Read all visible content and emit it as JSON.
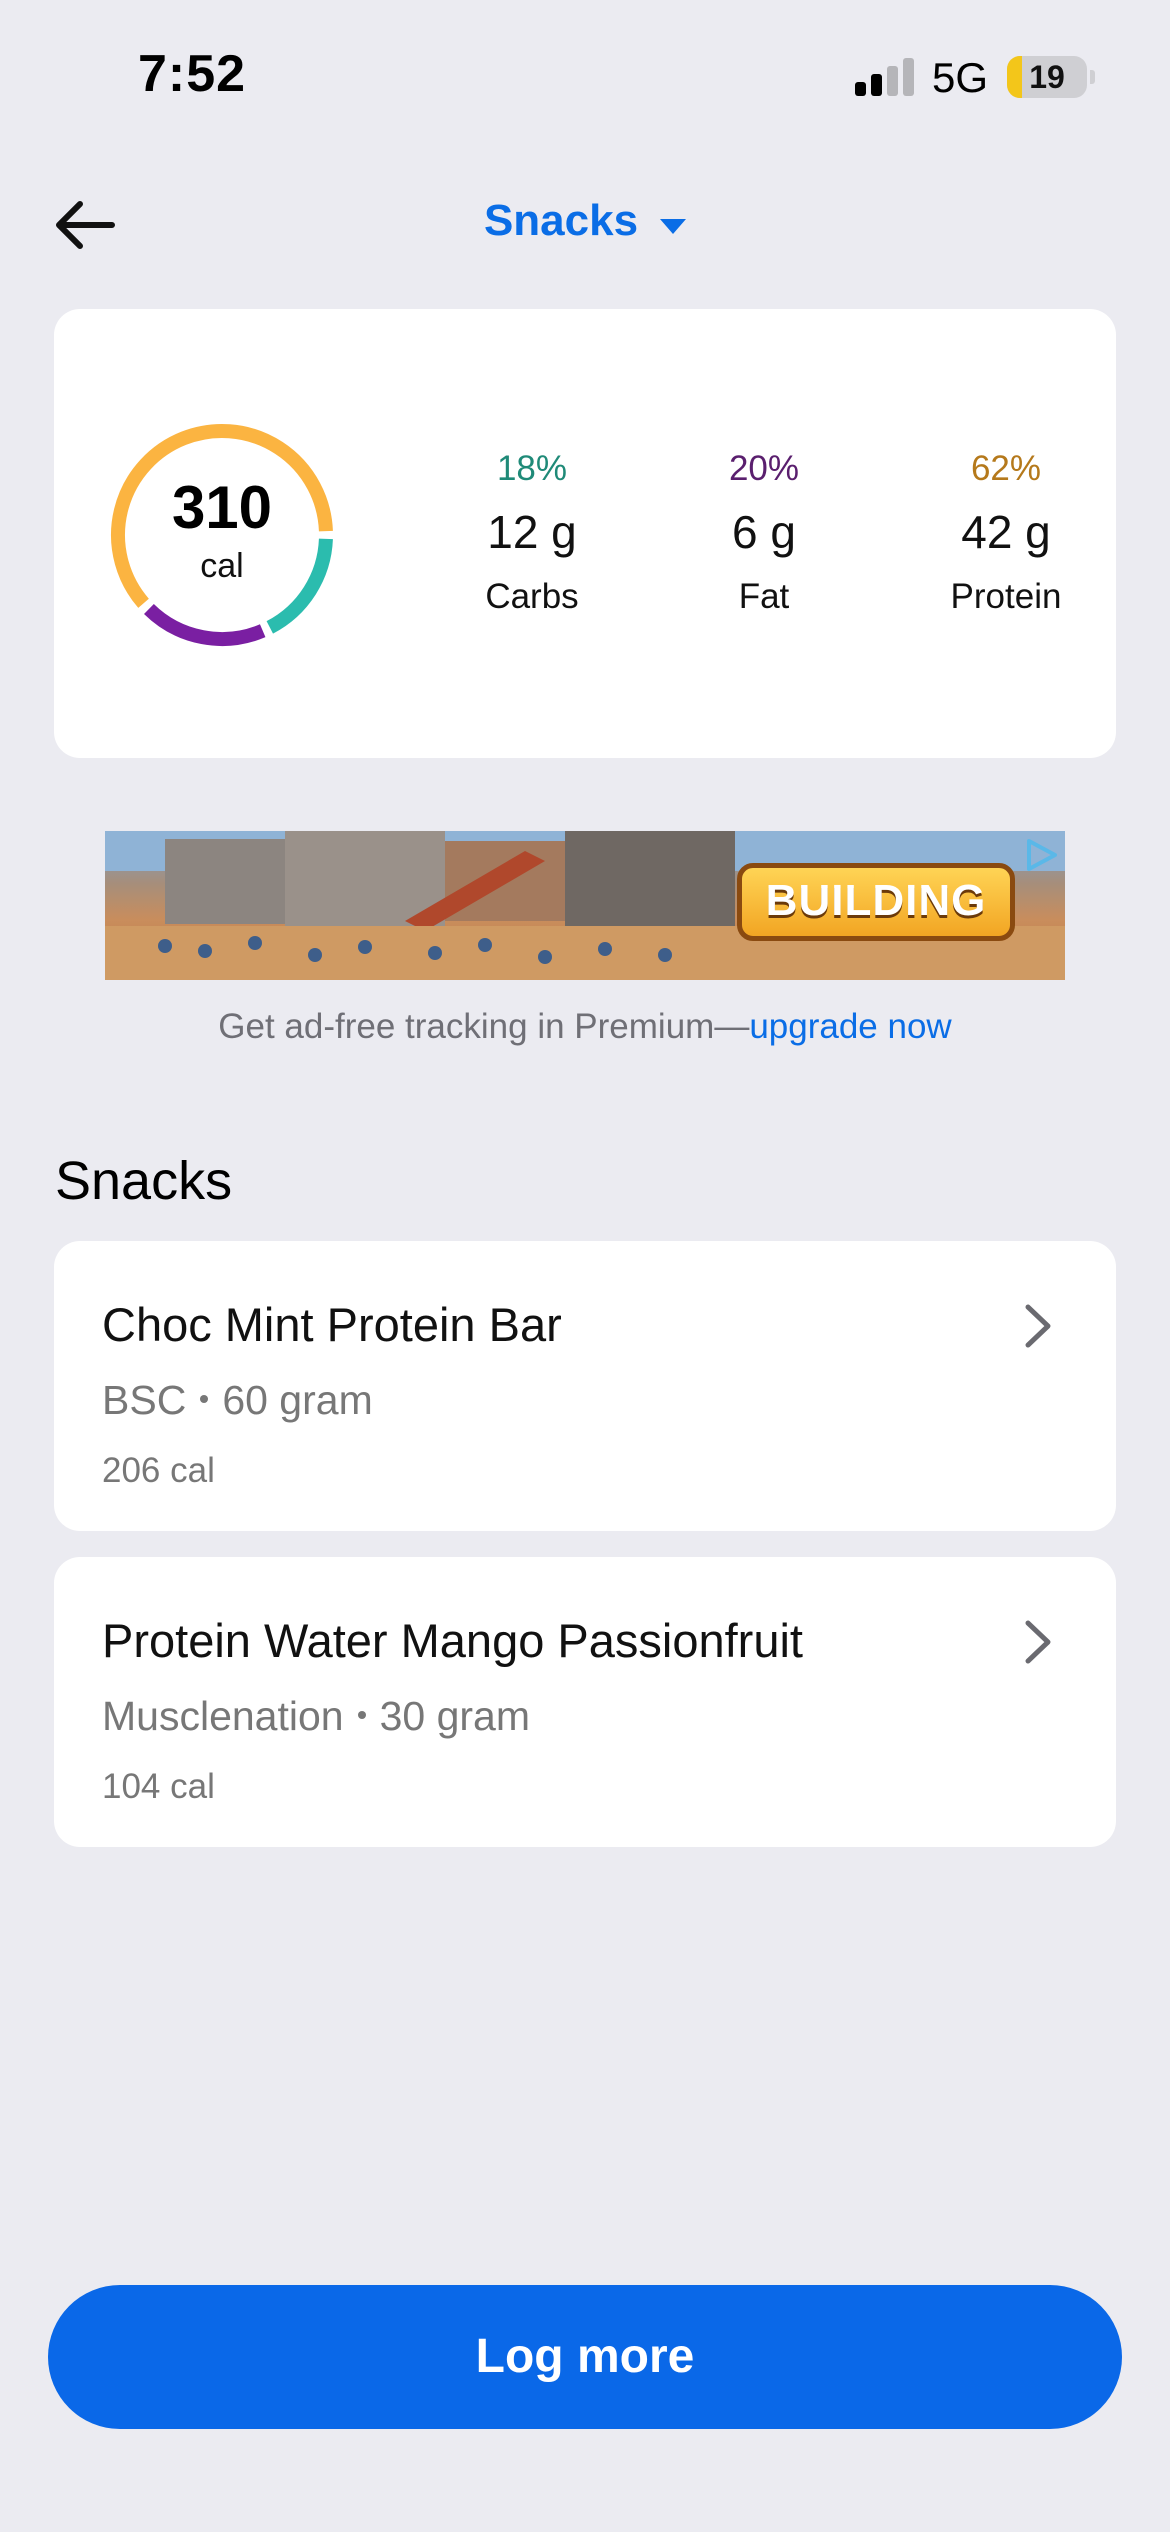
{
  "status_bar": {
    "time": "7:52",
    "network": "5G",
    "battery": "19",
    "battery_level": 0.19,
    "signal_bars_active": 2
  },
  "header": {
    "meal_label": "Snacks",
    "back_icon": "arrow-left-icon",
    "dropdown_icon": "caret-down-icon"
  },
  "summary": {
    "calories": "310",
    "calories_unit": "cal",
    "macros": [
      {
        "percent": "18%",
        "grams": "12 g",
        "name": "Carbs",
        "color": "#1f8a78"
      },
      {
        "percent": "20%",
        "grams": "6 g",
        "name": "Fat",
        "color": "#5a1f6e"
      },
      {
        "percent": "62%",
        "grams": "42 g",
        "name": "Protein",
        "color": "#b5791b"
      }
    ],
    "ring_colors": {
      "carbs": "#2bbcae",
      "fat": "#7a1fa2",
      "protein": "#fbb441"
    }
  },
  "ad": {
    "badge_text": "BUILDING",
    "premium_text": "Get ad-free tracking in Premium—",
    "premium_link": "upgrade now"
  },
  "section": {
    "title": "Snacks"
  },
  "items": [
    {
      "name": "Choc Mint Protein Bar",
      "brand": "BSC",
      "serving": "60 gram",
      "calories": "206 cal"
    },
    {
      "name": "Protein Water Mango Passionfruit",
      "brand": "Musclenation",
      "serving": "30 gram",
      "calories": "104 cal"
    }
  ],
  "actions": {
    "log_more": "Log more"
  },
  "colors": {
    "accent": "#0a6de6",
    "background": "#ebebf1"
  }
}
